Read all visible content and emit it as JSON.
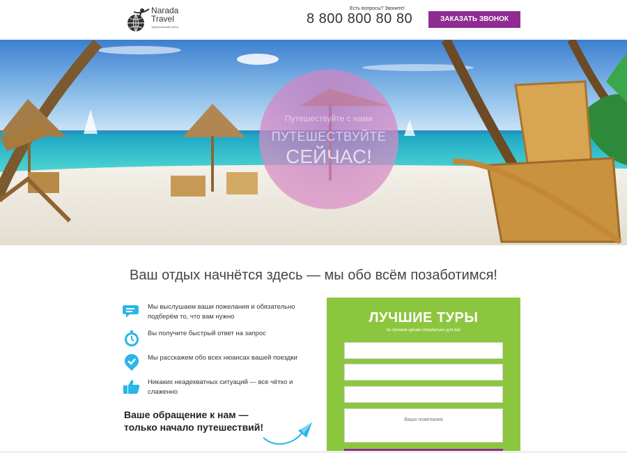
{
  "header": {
    "logo_line1": "Narada",
    "logo_line2": "Travel",
    "logo_sub": "Туристический центр",
    "ask_label": "Есть вопросы? Звоните!",
    "phone": "8 800 800 80 80",
    "call_button": "ЗАКАЗАТЬ ЗВОНОК"
  },
  "hero": {
    "small_text": "Путешествуйте с нами",
    "mid_text": "ПУТЕШЕСТВУЙТЕ",
    "big_text": "СЕЙЧАС!"
  },
  "tagline": "Ваш отдых начнётся здесь — мы обо всём позаботимся!",
  "features": [
    {
      "icon": "chat-icon",
      "text": "Мы выслушаем ваши пожелания и обязательно подберём то, что вам нужно"
    },
    {
      "icon": "stopwatch-icon",
      "text": "Вы получите быстрый ответ на запрос"
    },
    {
      "icon": "check-pin-icon",
      "text": "Мы расскажем обо всех нюансах вашей поездки"
    },
    {
      "icon": "thumbs-up-icon",
      "text": "Никаких неадекватных ситуаций — все чётко и слаженно"
    }
  ],
  "bold_note_line1": "Ваше обращение к нам —",
  "bold_note_line2": "только начало путешествий!",
  "form": {
    "title": "ЛУЧШИЕ ТУРЫ",
    "subtitle": "по лучшим ценам специально для вас",
    "wishes_placeholder": "Ваши пожелания"
  },
  "colors": {
    "accent_purple": "#8e2c92",
    "form_green": "#8cc63f",
    "icon_blue": "#29b6e8"
  }
}
